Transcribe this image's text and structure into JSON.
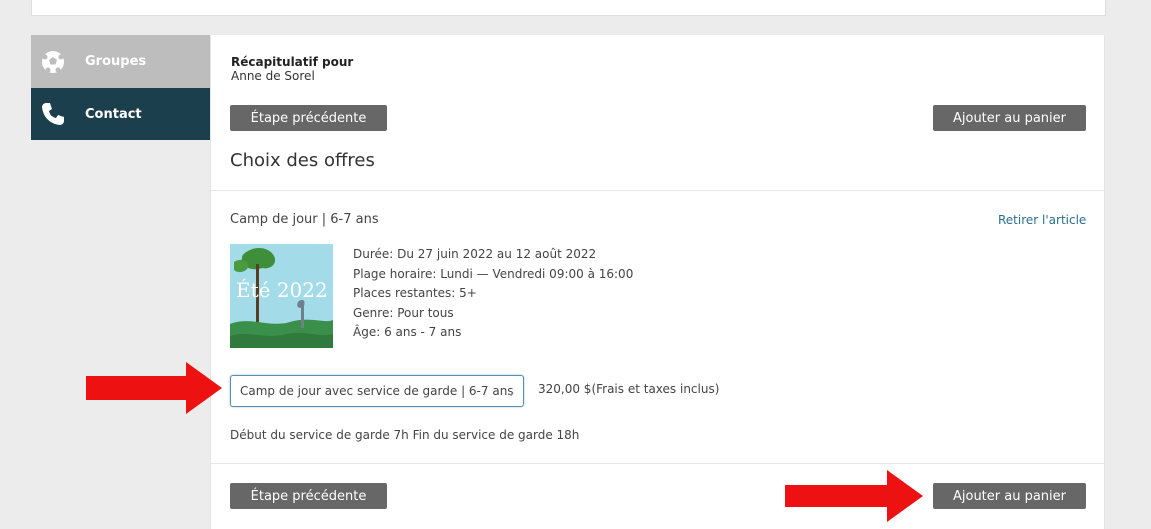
{
  "sidebar": {
    "items": [
      {
        "label": "Groupes",
        "icon": "soccer-ball-icon"
      },
      {
        "label": "Contact",
        "icon": "phone-icon"
      }
    ]
  },
  "recap": {
    "title": "Récapitulatif pour",
    "name": "Anne de Sorel"
  },
  "buttons": {
    "previous": "Étape précédente",
    "add_to_cart": "Ajouter au panier"
  },
  "section_title": "Choix des offres",
  "product": {
    "name": "Camp de jour | 6-7 ans",
    "remove_label": "Retirer l'article",
    "thumbnail_text": "Été 2022",
    "details": [
      "Durée: Du 27 juin 2022 au 12 août 2022",
      "Plage horaire: Lundi — Vendredi 09:00 à 16:00",
      "Places restantes: 5+",
      "Genre: Pour tous",
      "Âge: 6 ans - 7 ans"
    ],
    "selected_option": "Camp de jour avec service de garde | 6-7 ans",
    "price": "320,00 $(Frais et taxes inclus)",
    "service_note": "Début du service de garde 7h Fin du service de garde 18h"
  },
  "colors": {
    "sidebar_active": "#1b3f4d",
    "sidebar_inactive": "#bdbdbd",
    "button": "#676767",
    "link": "#2a6f8f",
    "annotation_arrow": "#ee1111"
  }
}
